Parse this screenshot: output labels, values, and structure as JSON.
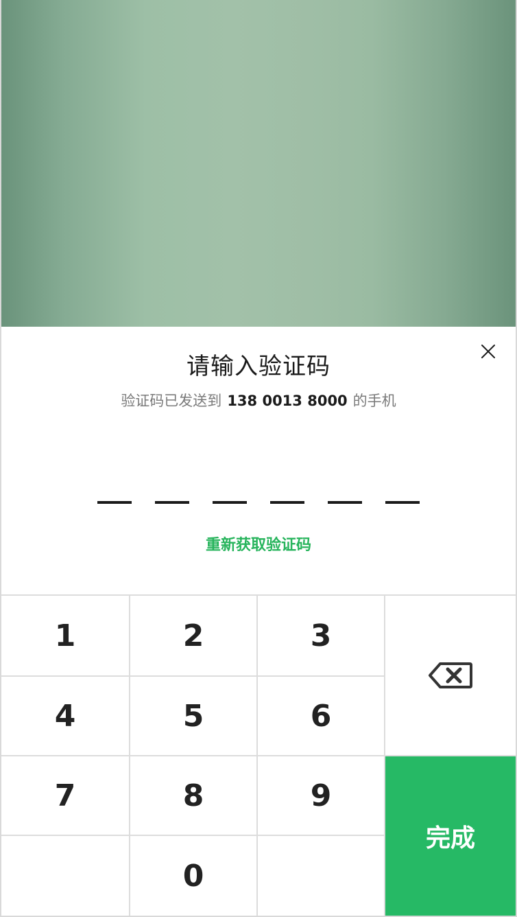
{
  "dialog": {
    "title": "请输入验证码",
    "subtitle_prefix": "验证码已发送到",
    "phone": "138 0013 8000",
    "subtitle_suffix": "的手机",
    "close_icon": "close-icon",
    "resend_label": "重新获取验证码",
    "code_slots": [
      "",
      "",
      "",
      "",
      "",
      ""
    ]
  },
  "keypad": {
    "keys": [
      "1",
      "2",
      "3",
      "4",
      "5",
      "6",
      "7",
      "8",
      "9",
      "0"
    ],
    "delete_icon": "backspace-icon",
    "done_label": "完成"
  },
  "colors": {
    "accent": "#26b965",
    "text_primary": "#1a1a1a",
    "text_secondary": "#7a7a7a"
  }
}
